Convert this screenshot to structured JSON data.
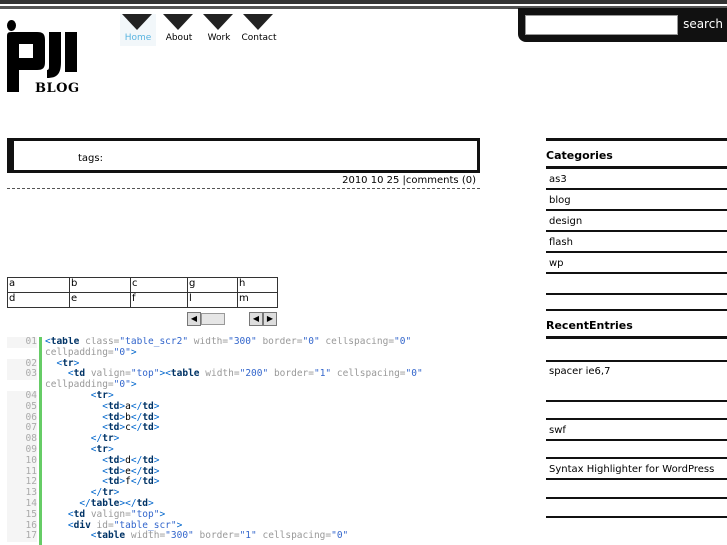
{
  "search": {
    "button_label": "search",
    "placeholder": ""
  },
  "logo": {
    "text": "BLOG"
  },
  "nav": {
    "items": [
      {
        "label": "Home"
      },
      {
        "label": "About"
      },
      {
        "label": "Work"
      },
      {
        "label": "Contact"
      }
    ]
  },
  "post": {
    "tags_label": "tags:",
    "date": "2010 10 25",
    "comments": "comments (0)"
  },
  "table": {
    "rows": [
      [
        "a",
        "b",
        "c",
        "g",
        "h"
      ],
      [
        "d",
        "e",
        "f",
        "l",
        "m"
      ]
    ]
  },
  "code_lines": [
    {
      "num": "01",
      "html": "<span class='tag'>&lt;</span><span class='kw'>table</span> <span class='attr'>class=</span><span class='str'>\"table_scr2\"</span> <span class='attr'>width=</span><span class='str'>\"300\"</span> <span class='attr'>border=</span><span class='str'>\"0\"</span> <span class='attr'>cellspacing=</span><span class='str'>\"0\"</span>"
    },
    {
      "num": "",
      "html": "<span class='attr'>cellpadding=</span><span class='str'>\"0\"</span><span class='tag'>&gt;</span>"
    },
    {
      "num": "02",
      "html": "  <span class='tag'>&lt;</span><span class='kw'>tr</span><span class='tag'>&gt;</span>"
    },
    {
      "num": "03",
      "html": "    <span class='tag'>&lt;</span><span class='kw'>td</span> <span class='attr'>valign=</span><span class='str'>\"top\"</span><span class='tag'>&gt;&lt;</span><span class='kw'>table</span> <span class='attr'>width=</span><span class='str'>\"200\"</span> <span class='attr'>border=</span><span class='str'>\"1\"</span> <span class='attr'>cellspacing=</span><span class='str'>\"0\"</span>"
    },
    {
      "num": "",
      "html": "<span class='attr'>cellpadding=</span><span class='str'>\"0\"</span><span class='tag'>&gt;</span>"
    },
    {
      "num": "04",
      "html": "        <span class='tag'>&lt;</span><span class='kw'>tr</span><span class='tag'>&gt;</span>"
    },
    {
      "num": "05",
      "html": "          <span class='tag'>&lt;</span><span class='kw'>td</span><span class='tag'>&gt;</span>a<span class='tag'>&lt;/</span><span class='kw'>td</span><span class='tag'>&gt;</span>"
    },
    {
      "num": "06",
      "html": "          <span class='tag'>&lt;</span><span class='kw'>td</span><span class='tag'>&gt;</span>b<span class='tag'>&lt;/</span><span class='kw'>td</span><span class='tag'>&gt;</span>"
    },
    {
      "num": "07",
      "html": "          <span class='tag'>&lt;</span><span class='kw'>td</span><span class='tag'>&gt;</span>c<span class='tag'>&lt;/</span><span class='kw'>td</span><span class='tag'>&gt;</span>"
    },
    {
      "num": "08",
      "html": "        <span class='tag'>&lt;/</span><span class='kw'>tr</span><span class='tag'>&gt;</span>"
    },
    {
      "num": "09",
      "html": "        <span class='tag'>&lt;</span><span class='kw'>tr</span><span class='tag'>&gt;</span>"
    },
    {
      "num": "10",
      "html": "          <span class='tag'>&lt;</span><span class='kw'>td</span><span class='tag'>&gt;</span>d<span class='tag'>&lt;/</span><span class='kw'>td</span><span class='tag'>&gt;</span>"
    },
    {
      "num": "11",
      "html": "          <span class='tag'>&lt;</span><span class='kw'>td</span><span class='tag'>&gt;</span>e<span class='tag'>&lt;/</span><span class='kw'>td</span><span class='tag'>&gt;</span>"
    },
    {
      "num": "12",
      "html": "          <span class='tag'>&lt;</span><span class='kw'>td</span><span class='tag'>&gt;</span>f<span class='tag'>&lt;/</span><span class='kw'>td</span><span class='tag'>&gt;</span>"
    },
    {
      "num": "13",
      "html": "        <span class='tag'>&lt;/</span><span class='kw'>tr</span><span class='tag'>&gt;</span>"
    },
    {
      "num": "14",
      "html": "      <span class='tag'>&lt;/</span><span class='kw'>table</span><span class='tag'>&gt;&lt;/</span><span class='kw'>td</span><span class='tag'>&gt;</span>"
    },
    {
      "num": "15",
      "html": "    <span class='tag'>&lt;</span><span class='kw'>td</span> <span class='attr'>valign=</span><span class='str'>\"top\"</span><span class='tag'>&gt;</span>"
    },
    {
      "num": "16",
      "html": "    <span class='tag'>&lt;</span><span class='kw'>div</span> <span class='attr'>id=</span><span class='str'>\"table_scr\"</span><span class='tag'>&gt;</span>"
    },
    {
      "num": "17",
      "html": "        <span class='tag'>&lt;</span><span class='kw'>table</span> <span class='attr'>width=</span><span class='str'>\"300\"</span> <span class='attr'>border=</span><span class='str'>\"1\"</span> <span class='attr'>cellspacing=</span><span class='str'>\"0\"</span>"
    }
  ],
  "sidebar": {
    "categories_title": "Categories",
    "categories": [
      "as3",
      "blog",
      "design",
      "flash",
      "wp"
    ],
    "recent_title": "RecentEntries",
    "recent": [
      "spacer ie6,7",
      "swf",
      "Syntax Highlighter for WordPress"
    ]
  }
}
